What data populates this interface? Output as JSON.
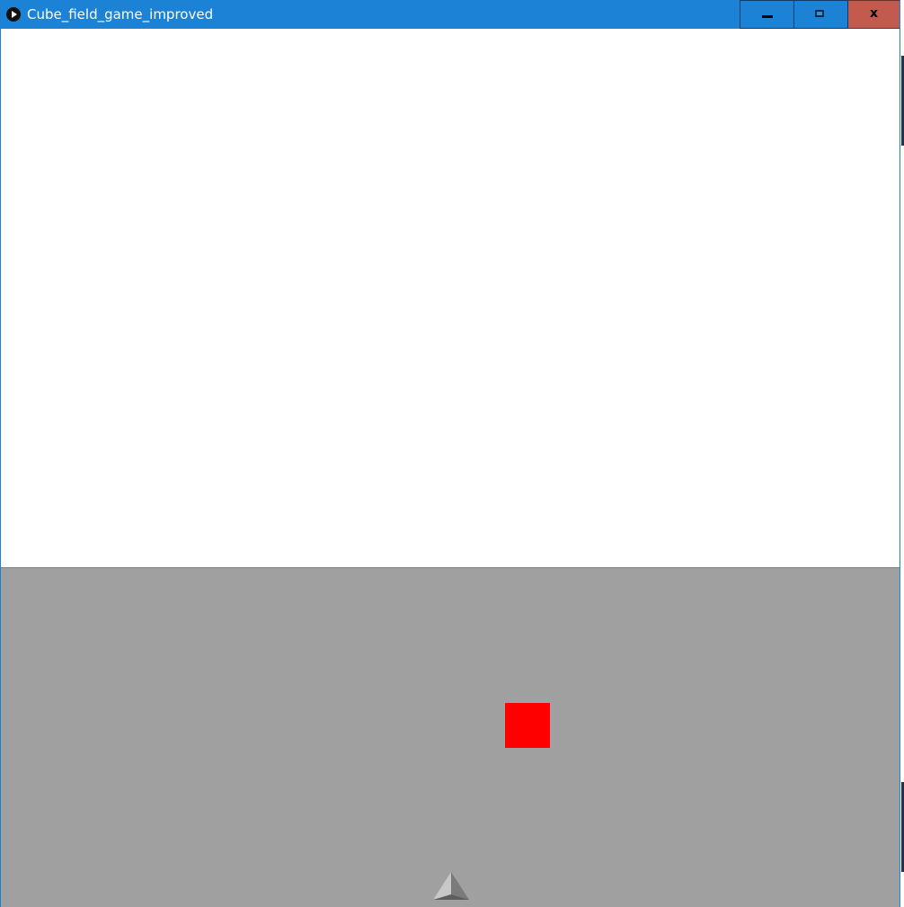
{
  "window": {
    "title": "Cube_field_game_improved",
    "app_icon": "play-icon",
    "controls": {
      "minimize_icon": "minimize-icon",
      "maximize_icon": "maximize-icon",
      "close_label": "x"
    },
    "colors": {
      "titlebar": "#1b82d6",
      "close_button": "#c25a4e"
    }
  },
  "game": {
    "sky_color": "#ffffff",
    "ground_color": "#a0a0a0",
    "obstacle": {
      "type": "cube",
      "color": "#ff0000"
    },
    "player": {
      "type": "ship",
      "icon": "pyramid-ship-icon",
      "color": "#8a8a8a"
    }
  }
}
